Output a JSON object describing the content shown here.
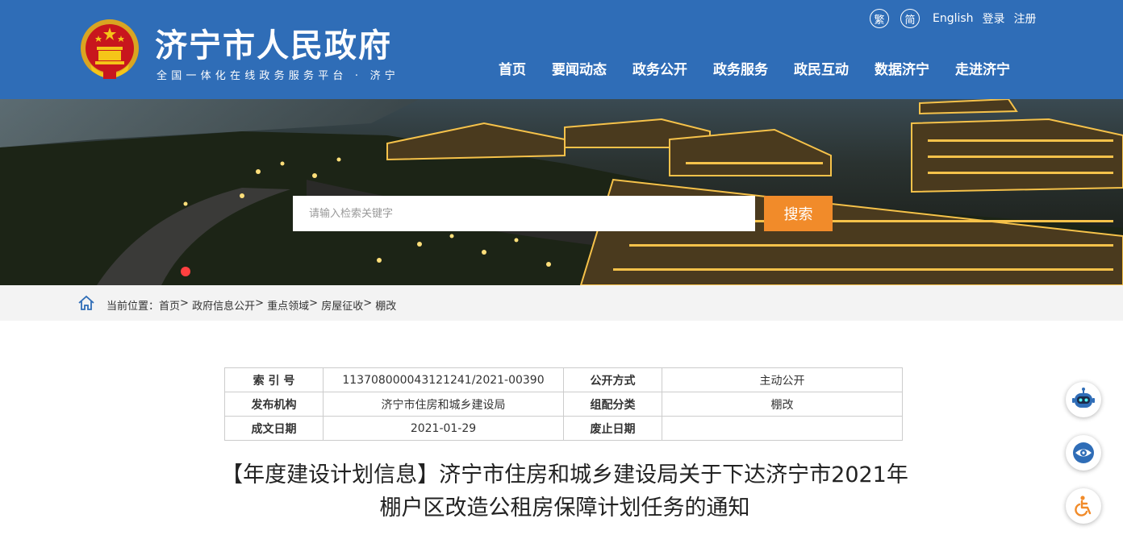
{
  "header": {
    "title": "济宁市人民政府",
    "subtitle": "全国一体化在线政务服务平台 · 济宁",
    "top_links": {
      "traditional": "繁",
      "simplified": "简",
      "english": "English",
      "login": "登录",
      "register": "注册"
    },
    "nav": [
      "首页",
      "要闻动态",
      "政务公开",
      "政务服务",
      "政民互动",
      "数据济宁",
      "走进济宁"
    ]
  },
  "search": {
    "placeholder": "请输入检索关键字",
    "button": "搜索"
  },
  "breadcrumb": {
    "label": "当前位置：",
    "items": [
      "首页",
      "政府信息公开",
      "重点领域",
      "房屋征收",
      "棚改"
    ],
    "separator": ">"
  },
  "info_table": {
    "rows": [
      [
        {
          "k": "索 引 号",
          "v": "11370800004312124​1/2021-00390"
        },
        {
          "k": "公开方式",
          "v": "主动公开"
        }
      ],
      [
        {
          "k": "发布机构",
          "v": "济宁市住房和城乡建设局"
        },
        {
          "k": "组配分类",
          "v": "棚改"
        }
      ],
      [
        {
          "k": "成文日期",
          "v": "2021-01-29"
        },
        {
          "k": "废止日期",
          "v": ""
        }
      ]
    ]
  },
  "document": {
    "title_line1": "【年度建设计划信息】济宁市住房和城乡建设局关于下达济宁市2021年",
    "title_line2": "棚户区改造公租房保障计划任务的通知"
  },
  "colors": {
    "header_bg": "#2f6db7",
    "search_button": "#f18b2a",
    "breadcrumb_bg": "#f3f3f3"
  }
}
